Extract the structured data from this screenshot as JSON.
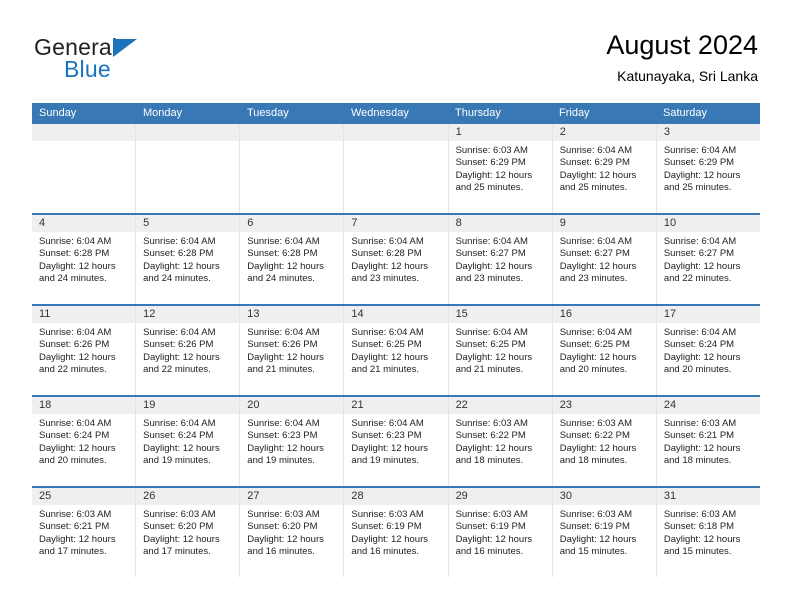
{
  "logo": {
    "primary_text": "General",
    "secondary_text": "Blue",
    "accent_color": "#1b74bb"
  },
  "header": {
    "title": "August 2024",
    "subtitle": "Katunayaka, Sri Lanka"
  },
  "theme": {
    "header_row_color": "#3878b4",
    "day_number_bg": "#efefef",
    "text_color": "#222222"
  },
  "calendar": {
    "weekday_labels": [
      "Sunday",
      "Monday",
      "Tuesday",
      "Wednesday",
      "Thursday",
      "Friday",
      "Saturday"
    ],
    "labels": {
      "sunrise_prefix": "Sunrise: ",
      "sunset_prefix": "Sunset: ",
      "daylight_prefix": "Daylight: "
    },
    "weeks": [
      [
        {
          "day": "",
          "empty": true
        },
        {
          "day": "",
          "empty": true
        },
        {
          "day": "",
          "empty": true
        },
        {
          "day": "",
          "empty": true
        },
        {
          "day": "1",
          "sunrise": "Sunrise: 6:03 AM",
          "sunset": "Sunset: 6:29 PM",
          "daylight_line1": "Daylight: 12 hours",
          "daylight_line2": "and 25 minutes."
        },
        {
          "day": "2",
          "sunrise": "Sunrise: 6:04 AM",
          "sunset": "Sunset: 6:29 PM",
          "daylight_line1": "Daylight: 12 hours",
          "daylight_line2": "and 25 minutes."
        },
        {
          "day": "3",
          "sunrise": "Sunrise: 6:04 AM",
          "sunset": "Sunset: 6:29 PM",
          "daylight_line1": "Daylight: 12 hours",
          "daylight_line2": "and 25 minutes."
        }
      ],
      [
        {
          "day": "4",
          "sunrise": "Sunrise: 6:04 AM",
          "sunset": "Sunset: 6:28 PM",
          "daylight_line1": "Daylight: 12 hours",
          "daylight_line2": "and 24 minutes."
        },
        {
          "day": "5",
          "sunrise": "Sunrise: 6:04 AM",
          "sunset": "Sunset: 6:28 PM",
          "daylight_line1": "Daylight: 12 hours",
          "daylight_line2": "and 24 minutes."
        },
        {
          "day": "6",
          "sunrise": "Sunrise: 6:04 AM",
          "sunset": "Sunset: 6:28 PM",
          "daylight_line1": "Daylight: 12 hours",
          "daylight_line2": "and 24 minutes."
        },
        {
          "day": "7",
          "sunrise": "Sunrise: 6:04 AM",
          "sunset": "Sunset: 6:28 PM",
          "daylight_line1": "Daylight: 12 hours",
          "daylight_line2": "and 23 minutes."
        },
        {
          "day": "8",
          "sunrise": "Sunrise: 6:04 AM",
          "sunset": "Sunset: 6:27 PM",
          "daylight_line1": "Daylight: 12 hours",
          "daylight_line2": "and 23 minutes."
        },
        {
          "day": "9",
          "sunrise": "Sunrise: 6:04 AM",
          "sunset": "Sunset: 6:27 PM",
          "daylight_line1": "Daylight: 12 hours",
          "daylight_line2": "and 23 minutes."
        },
        {
          "day": "10",
          "sunrise": "Sunrise: 6:04 AM",
          "sunset": "Sunset: 6:27 PM",
          "daylight_line1": "Daylight: 12 hours",
          "daylight_line2": "and 22 minutes."
        }
      ],
      [
        {
          "day": "11",
          "sunrise": "Sunrise: 6:04 AM",
          "sunset": "Sunset: 6:26 PM",
          "daylight_line1": "Daylight: 12 hours",
          "daylight_line2": "and 22 minutes."
        },
        {
          "day": "12",
          "sunrise": "Sunrise: 6:04 AM",
          "sunset": "Sunset: 6:26 PM",
          "daylight_line1": "Daylight: 12 hours",
          "daylight_line2": "and 22 minutes."
        },
        {
          "day": "13",
          "sunrise": "Sunrise: 6:04 AM",
          "sunset": "Sunset: 6:26 PM",
          "daylight_line1": "Daylight: 12 hours",
          "daylight_line2": "and 21 minutes."
        },
        {
          "day": "14",
          "sunrise": "Sunrise: 6:04 AM",
          "sunset": "Sunset: 6:25 PM",
          "daylight_line1": "Daylight: 12 hours",
          "daylight_line2": "and 21 minutes."
        },
        {
          "day": "15",
          "sunrise": "Sunrise: 6:04 AM",
          "sunset": "Sunset: 6:25 PM",
          "daylight_line1": "Daylight: 12 hours",
          "daylight_line2": "and 21 minutes."
        },
        {
          "day": "16",
          "sunrise": "Sunrise: 6:04 AM",
          "sunset": "Sunset: 6:25 PM",
          "daylight_line1": "Daylight: 12 hours",
          "daylight_line2": "and 20 minutes."
        },
        {
          "day": "17",
          "sunrise": "Sunrise: 6:04 AM",
          "sunset": "Sunset: 6:24 PM",
          "daylight_line1": "Daylight: 12 hours",
          "daylight_line2": "and 20 minutes."
        }
      ],
      [
        {
          "day": "18",
          "sunrise": "Sunrise: 6:04 AM",
          "sunset": "Sunset: 6:24 PM",
          "daylight_line1": "Daylight: 12 hours",
          "daylight_line2": "and 20 minutes."
        },
        {
          "day": "19",
          "sunrise": "Sunrise: 6:04 AM",
          "sunset": "Sunset: 6:24 PM",
          "daylight_line1": "Daylight: 12 hours",
          "daylight_line2": "and 19 minutes."
        },
        {
          "day": "20",
          "sunrise": "Sunrise: 6:04 AM",
          "sunset": "Sunset: 6:23 PM",
          "daylight_line1": "Daylight: 12 hours",
          "daylight_line2": "and 19 minutes."
        },
        {
          "day": "21",
          "sunrise": "Sunrise: 6:04 AM",
          "sunset": "Sunset: 6:23 PM",
          "daylight_line1": "Daylight: 12 hours",
          "daylight_line2": "and 19 minutes."
        },
        {
          "day": "22",
          "sunrise": "Sunrise: 6:03 AM",
          "sunset": "Sunset: 6:22 PM",
          "daylight_line1": "Daylight: 12 hours",
          "daylight_line2": "and 18 minutes."
        },
        {
          "day": "23",
          "sunrise": "Sunrise: 6:03 AM",
          "sunset": "Sunset: 6:22 PM",
          "daylight_line1": "Daylight: 12 hours",
          "daylight_line2": "and 18 minutes."
        },
        {
          "day": "24",
          "sunrise": "Sunrise: 6:03 AM",
          "sunset": "Sunset: 6:21 PM",
          "daylight_line1": "Daylight: 12 hours",
          "daylight_line2": "and 18 minutes."
        }
      ],
      [
        {
          "day": "25",
          "sunrise": "Sunrise: 6:03 AM",
          "sunset": "Sunset: 6:21 PM",
          "daylight_line1": "Daylight: 12 hours",
          "daylight_line2": "and 17 minutes."
        },
        {
          "day": "26",
          "sunrise": "Sunrise: 6:03 AM",
          "sunset": "Sunset: 6:20 PM",
          "daylight_line1": "Daylight: 12 hours",
          "daylight_line2": "and 17 minutes."
        },
        {
          "day": "27",
          "sunrise": "Sunrise: 6:03 AM",
          "sunset": "Sunset: 6:20 PM",
          "daylight_line1": "Daylight: 12 hours",
          "daylight_line2": "and 16 minutes."
        },
        {
          "day": "28",
          "sunrise": "Sunrise: 6:03 AM",
          "sunset": "Sunset: 6:19 PM",
          "daylight_line1": "Daylight: 12 hours",
          "daylight_line2": "and 16 minutes."
        },
        {
          "day": "29",
          "sunrise": "Sunrise: 6:03 AM",
          "sunset": "Sunset: 6:19 PM",
          "daylight_line1": "Daylight: 12 hours",
          "daylight_line2": "and 16 minutes."
        },
        {
          "day": "30",
          "sunrise": "Sunrise: 6:03 AM",
          "sunset": "Sunset: 6:19 PM",
          "daylight_line1": "Daylight: 12 hours",
          "daylight_line2": "and 15 minutes."
        },
        {
          "day": "31",
          "sunrise": "Sunrise: 6:03 AM",
          "sunset": "Sunset: 6:18 PM",
          "daylight_line1": "Daylight: 12 hours",
          "daylight_line2": "and 15 minutes."
        }
      ]
    ]
  }
}
